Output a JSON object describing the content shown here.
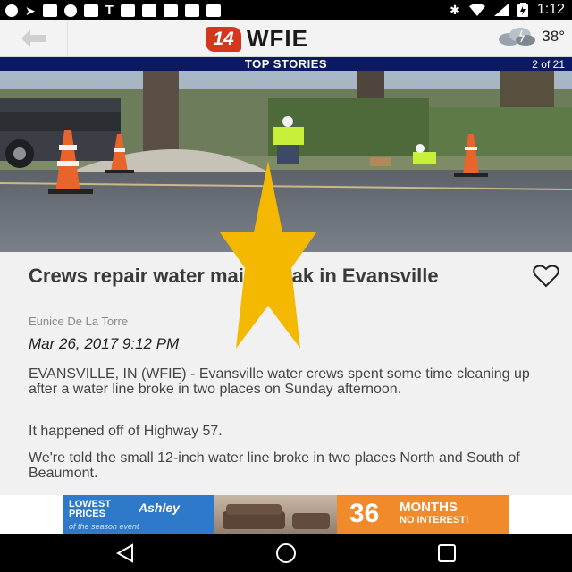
{
  "status_bar": {
    "time": "1:12",
    "left_icons": [
      "chat-icon",
      "send-icon",
      "facebook-icon",
      "keyhole-icon",
      "mail-icon",
      "t-icon",
      "blank-icon",
      "blank-icon",
      "blank-icon",
      "blank-icon",
      "blank-icon"
    ],
    "right_icons": [
      "bluetooth-icon",
      "wifi-icon",
      "signal-icon",
      "battery-icon"
    ]
  },
  "app_bar": {
    "back_icon": "back-arrow-icon",
    "logo_badge": "14",
    "logo_text": "WFIE",
    "weather_icon": "cloud-icon",
    "temperature": "38°"
  },
  "section": {
    "title": "TOP STORIES",
    "position": "2 of 21"
  },
  "article": {
    "headline": "Crews repair water main break in Evansville",
    "author": "Eunice De La Torre",
    "date": "Mar 26, 2017 9:12 PM",
    "paragraphs": [
      "EVANSVILLE, IN (WFIE) - Evansville water crews spent some time cleaning up after a water line broke in two places on Sunday afternoon.",
      "It happened off of Highway 57.",
      "We're told the small 12-inch water line broke in two places North and South of Beaumont."
    ],
    "favorite_icon": "heart-icon"
  },
  "ad": {
    "lowest": "LOWEST",
    "prices": "PRICES",
    "brand": "Ashley",
    "sub": "of the season event",
    "months_number": "36",
    "months": "MONTHS",
    "no_interest": "NO INTEREST!"
  },
  "colors": {
    "section_bg": "#0b1a63",
    "logo_red": "#d4371c",
    "overlay_star": "#f5b800",
    "ad_blue": "#2e79c9",
    "ad_orange": "#f08a2a"
  }
}
